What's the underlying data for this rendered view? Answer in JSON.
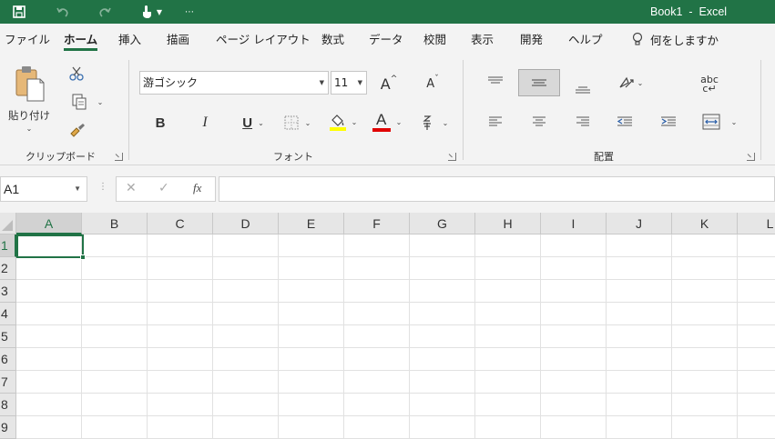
{
  "window": {
    "title": "Book1  -  Excel"
  },
  "tabs": [
    {
      "label": "ファイル",
      "active": false
    },
    {
      "label": "ホーム",
      "active": true
    },
    {
      "label": "挿入",
      "active": false
    },
    {
      "label": "描画",
      "active": false
    },
    {
      "label": "ページ レイアウト",
      "active": false
    },
    {
      "label": "数式",
      "active": false
    },
    {
      "label": "データ",
      "active": false
    },
    {
      "label": "校閲",
      "active": false
    },
    {
      "label": "表示",
      "active": false
    },
    {
      "label": "開発",
      "active": false
    },
    {
      "label": "ヘルプ",
      "active": false
    }
  ],
  "tell_me": {
    "placeholder": "何をしますか"
  },
  "clipboard": {
    "paste_label": "貼り付け",
    "group_label": "クリップボード"
  },
  "font": {
    "name": "游ゴシック",
    "size": "11",
    "group_label": "フォント",
    "bold": "B",
    "italic": "I",
    "underline": "U",
    "font_color_glyph": "A",
    "grow_glyph": "A",
    "shrink_glyph": "A",
    "highlight_color": "#ffff00",
    "font_color": "#e00000"
  },
  "alignment": {
    "group_label": "配置",
    "wrap_text_glyph": "abc"
  },
  "formula_bar": {
    "name_box": "A1",
    "cancel": "✕",
    "enter": "✓",
    "fx": "fx",
    "formula": ""
  },
  "grid": {
    "columns": [
      "A",
      "B",
      "C",
      "D",
      "E",
      "F",
      "G",
      "H",
      "I",
      "J",
      "K",
      "L"
    ],
    "rows": [
      "1",
      "2",
      "3",
      "4",
      "5",
      "6",
      "7",
      "8",
      "9"
    ],
    "selected_cell": "A1"
  },
  "colors": {
    "accent": "#217346",
    "ribbon_bg": "#f3f3f3",
    "header_bg": "#e6e6e6"
  }
}
